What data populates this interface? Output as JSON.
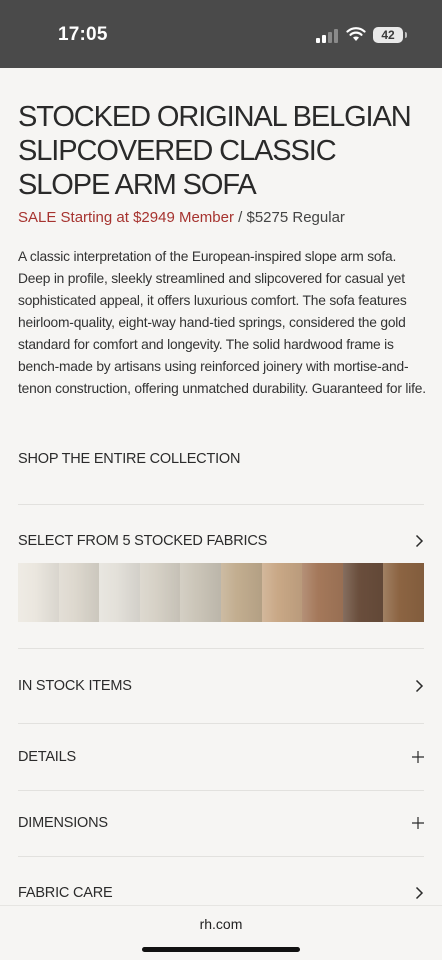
{
  "status_bar": {
    "time": "17:05",
    "battery": "42"
  },
  "product": {
    "title": "STOCKED ORIGINAL BELGIAN SLIPCOVERED CLASSIC SLOPE ARM SOFA",
    "sale_label": "SALE Starting at ",
    "member_price": "$2949 Member",
    "separator": " / ",
    "regular_price": "$5275 Regular",
    "description": "A classic interpretation of the European-inspired slope arm sofa. Deep in profile, sleekly streamlined and slipcovered for casual yet sophisticated appeal, it offers luxurious comfort. The sofa features heirloom-quality, eight-way hand-tied springs, considered the gold standard for comfort and longevity. The solid hardwood frame is bench-made by artisans using reinforced joinery with mortise-and-tenon construction, offering unmatched durability. Guaranteed for life."
  },
  "shop_collection": "SHOP THE ENTIRE COLLECTION",
  "fabrics": {
    "label": "SELECT FROM 5 STOCKED FABRICS",
    "swatch_colors": [
      "#ebe7df",
      "#ddd8ce",
      "#e4e1da",
      "#d6d1c6",
      "#cbc5b8",
      "#c2ad8f",
      "#c9a886",
      "#a4785a",
      "#6a4e3c",
      "#8c6442"
    ]
  },
  "sections": {
    "in_stock": "IN STOCK ITEMS",
    "details": "DETAILS",
    "dimensions": "DIMENSIONS",
    "fabric_care": "FABRIC CARE"
  },
  "browser": {
    "url": "rh.com"
  }
}
